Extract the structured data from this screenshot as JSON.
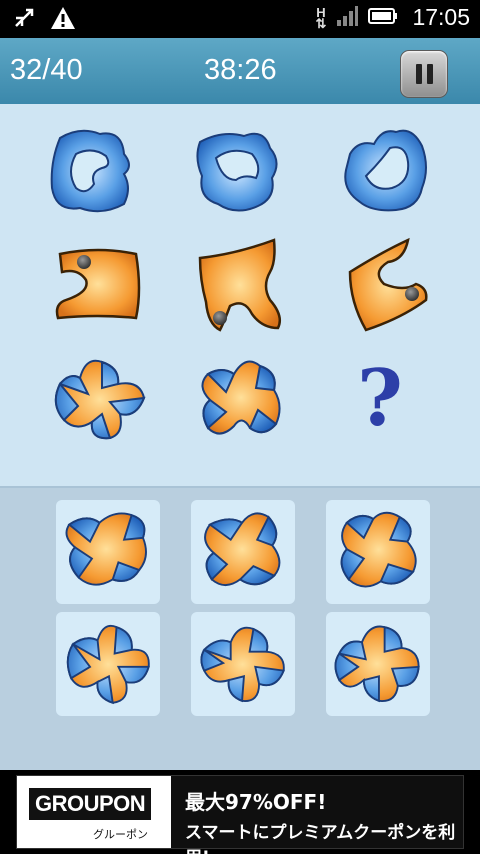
{
  "status_bar": {
    "time": "17:05",
    "network": "H",
    "icons": [
      "usb-debug-icon",
      "warning-icon",
      "network-hplus-icon",
      "signal-icon",
      "battery-icon"
    ]
  },
  "header": {
    "score": "32/40",
    "timer": "38:26",
    "pause_icon": "pause-icon"
  },
  "puzzle": {
    "rows": [
      [
        "blue-ring-shape",
        "blue-ring-shape",
        "blue-ring-shape"
      ],
      [
        "orange-dot-shape",
        "orange-dot-shape",
        "orange-dot-shape"
      ],
      [
        "star-puzzle-shape",
        "star-puzzle-shape",
        "question"
      ]
    ],
    "question_mark": "?"
  },
  "choices": {
    "count": 6
  },
  "ad": {
    "brand": "GROUPON",
    "brand_kana": "グルーポン",
    "line1": "最大97%OFF!",
    "line2": "スマートにプレミアムクーポンを利用!"
  },
  "colors": {
    "header": "#4a98b9",
    "puzzle_bg": "#cfe5f3",
    "choice_bg": "#d6ebf8",
    "blue_shape": "#3b7fd0",
    "orange_shape": "#f0922e",
    "question": "#2d3fa8"
  }
}
